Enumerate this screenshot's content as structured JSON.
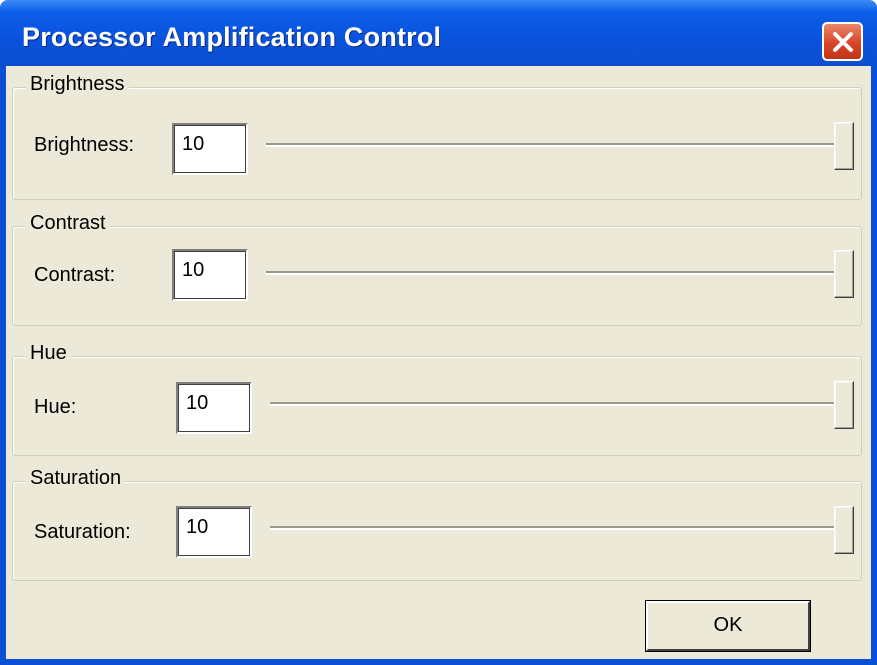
{
  "window": {
    "title": "Processor Amplification Control",
    "close_icon": "close-x"
  },
  "groups": [
    {
      "title": "Brightness",
      "label": "Brightness:",
      "value": "10",
      "slider_level": 1.0
    },
    {
      "title": "Contrast",
      "label": "Contrast:",
      "value": "10",
      "slider_level": 1.0
    },
    {
      "title": "Hue",
      "label": "Hue:",
      "value": "10",
      "slider_level": 1.0
    },
    {
      "title": "Saturation",
      "label": "Saturation:",
      "value": "10",
      "slider_level": 1.0
    }
  ],
  "buttons": {
    "ok_label": "OK"
  },
  "colors": {
    "titlebar": "#0a52dc",
    "client": "#ece9d8",
    "close": "#d9442a"
  }
}
